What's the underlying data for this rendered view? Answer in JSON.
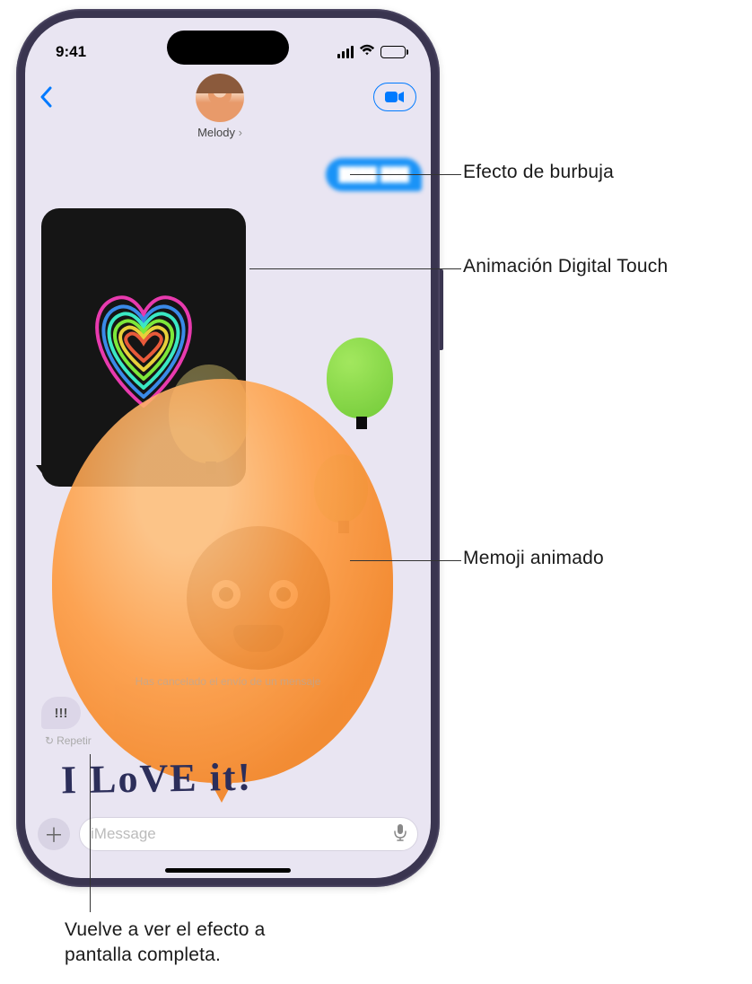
{
  "status": {
    "time": "9:41"
  },
  "contact": {
    "name": "Melody"
  },
  "bubble_text": "████ ███",
  "status_line": "Has cancelado el envío de un mensaje",
  "tapback": "!!!",
  "repeat_label": "Repetir",
  "handwriting": "I LoVE it!",
  "input_placeholder": "iMessage",
  "callouts": {
    "bubble": "Efecto de burbuja",
    "digital_touch": "Animación Digital Touch",
    "memoji": "Memoji animado",
    "fullscreen": "Vuelve a ver el efecto a pantalla completa."
  }
}
